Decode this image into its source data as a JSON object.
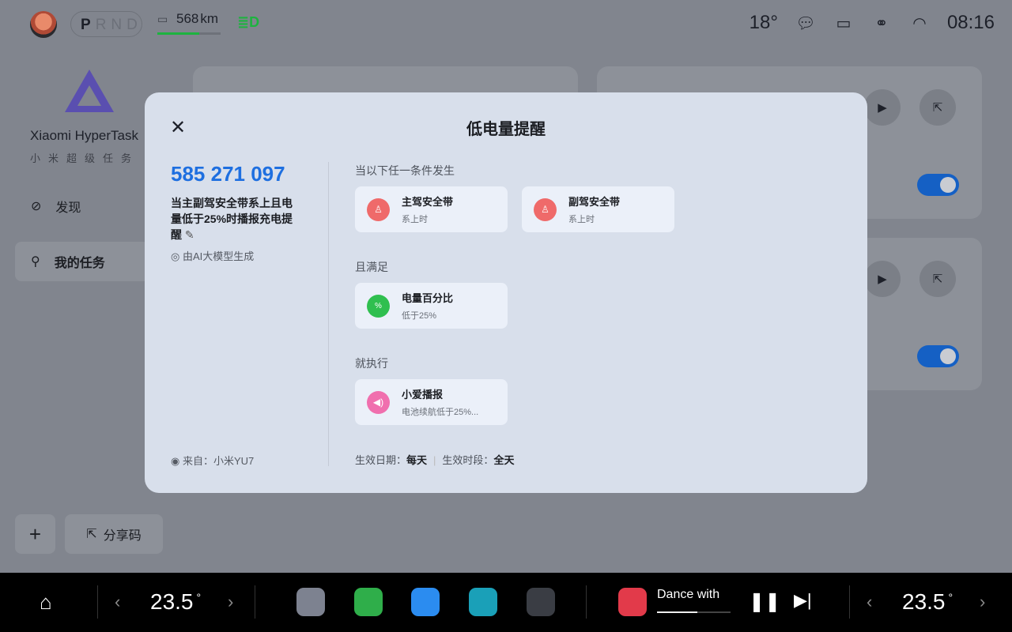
{
  "status": {
    "gears": {
      "active": "P",
      "others": "RND"
    },
    "range": "568",
    "range_unit": "km",
    "battery_fraction": 0.66,
    "temperature": "18°",
    "time": "08:16"
  },
  "sidebar": {
    "brand": "Xiaomi HyperTask",
    "brand_cn": "小米超级任务",
    "items": [
      {
        "label": "发现"
      },
      {
        "label": "我的任务"
      }
    ],
    "add": "+",
    "share": "分享码"
  },
  "modal": {
    "title": "低电量提醒",
    "code": "585 271 097",
    "description": "当主副驾安全带系上且电量低于25%时播报充电提醒",
    "ai_note": "由AI大模型生成",
    "source": "来自：小米YU7",
    "trigger_label": "当以下任一条件发生",
    "triggers": [
      {
        "title": "主驾安全带",
        "sub": "系上时"
      },
      {
        "title": "副驾安全带",
        "sub": "系上时"
      }
    ],
    "condition_label": "且满足",
    "conditions": [
      {
        "title": "电量百分比",
        "sub": "低于25%"
      }
    ],
    "action_label": "就执行",
    "actions": [
      {
        "title": "小爱播报",
        "sub": "电池续航低于25%..."
      }
    ],
    "date_label": "生效日期：",
    "date_value": "每天",
    "period_label": "生效时段：",
    "period_value": "全天"
  },
  "dock": {
    "left_temp": "23.5",
    "right_temp": "23.5",
    "degree": "°",
    "song": "Dance with",
    "song_progress": 0.55
  },
  "colors": {
    "accent": "#1e6fe0",
    "seatbelt": "#ef6a6a",
    "battery": "#2fbf4f",
    "speaker": "#f06fae"
  }
}
